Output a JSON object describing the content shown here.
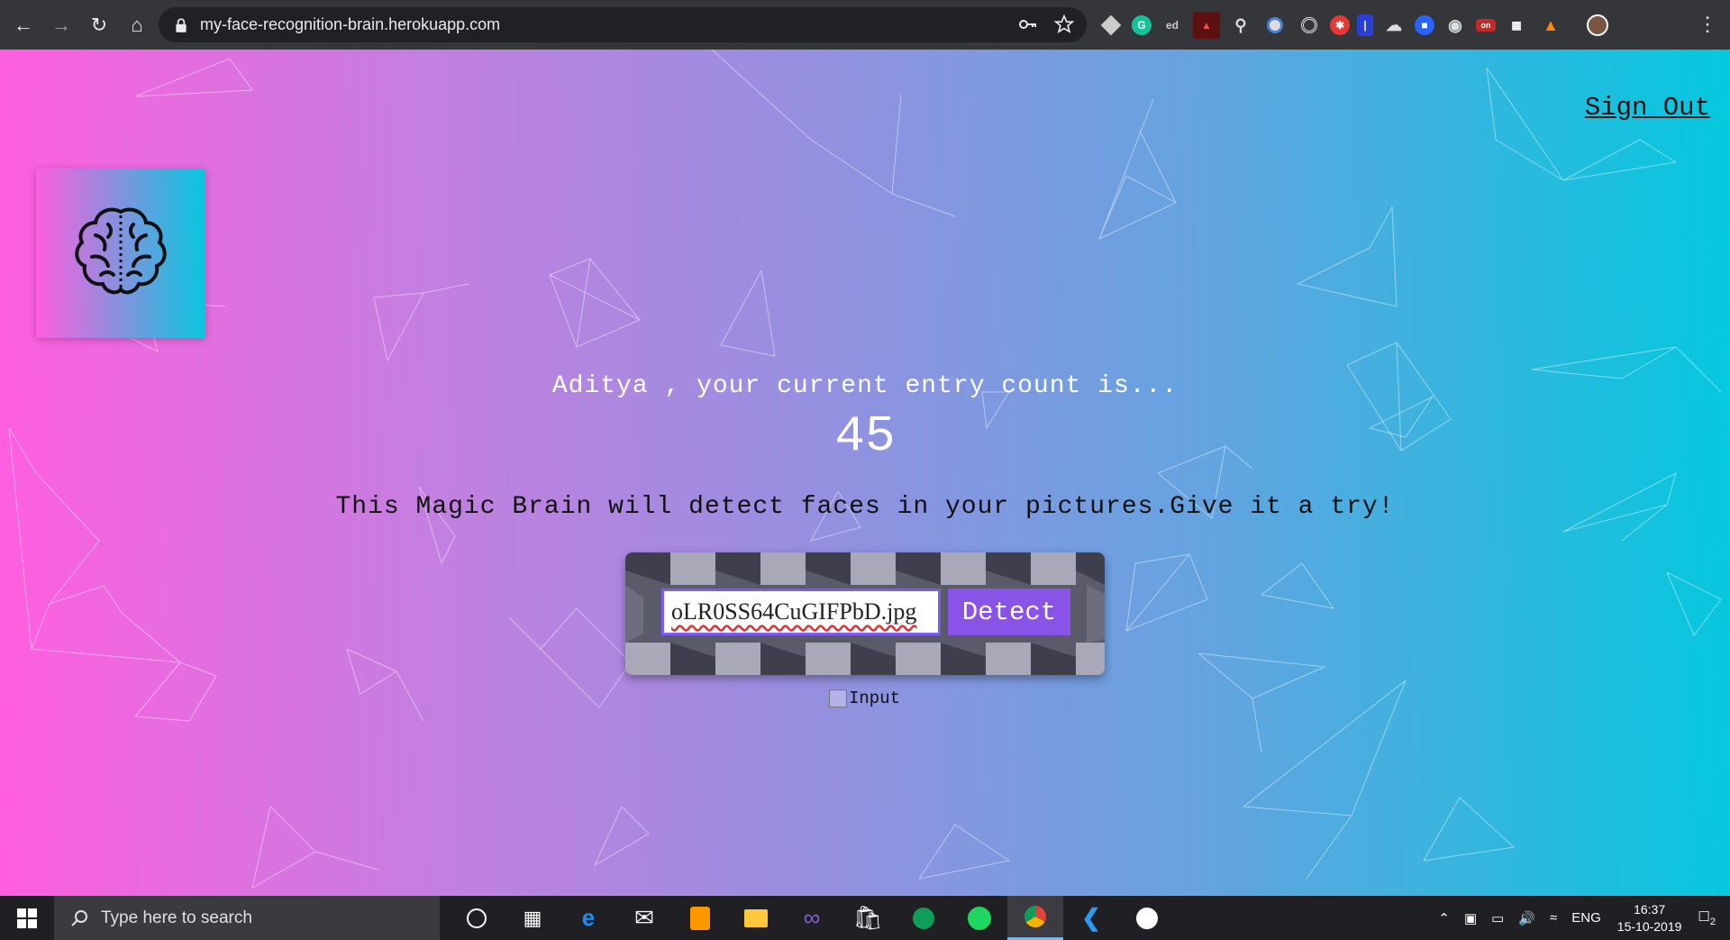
{
  "browser": {
    "url": "my-face-recognition-brain.herokuapp.com",
    "nav": [
      "back",
      "forward",
      "reload",
      "home"
    ]
  },
  "extensions": [
    "cube",
    "G",
    "ed",
    "pdf",
    "bulb",
    "circle",
    "target",
    "bug",
    "bar",
    "cloud",
    "shield",
    "msg",
    "red",
    "0",
    "fox"
  ],
  "page": {
    "sign_out": "Sign Out",
    "greeting": "Aditya , your current entry count is...",
    "count": "45",
    "tagline": "This Magic Brain will detect faces in your pictures.Give it a try!",
    "input_value": "oLR0SS64CuGIFPbD.jpg",
    "detect_label": "Detect",
    "checkbox_label": "Input"
  },
  "taskbar": {
    "search_placeholder": "Type here to search",
    "language": "ENG",
    "time": "16:37",
    "date": "15-10-2019",
    "notification_count": "2"
  },
  "colors": {
    "gradient_left": "#ff5edf",
    "gradient_right": "#04c8de",
    "detect_button": "#8a53e8"
  }
}
